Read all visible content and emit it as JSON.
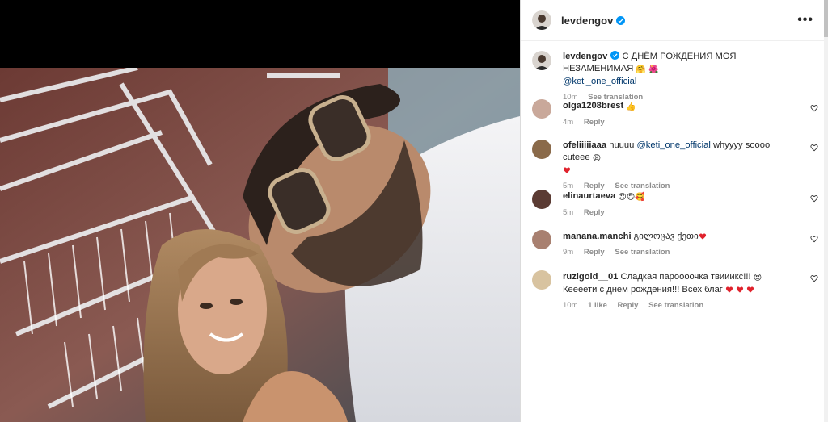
{
  "post": {
    "author": "levdengov",
    "more_icon": "more-horizontal-icon",
    "caption": {
      "user": "levdengov",
      "text": "С ДНЁМ РОЖДЕНИЯ МОЯ НЕЗАМЕНИМАЯ",
      "emojis": [
        "🤗",
        "🌺"
      ],
      "mention": "@keti_one_official",
      "time": "10m",
      "see_translation": "See translation"
    }
  },
  "comments": [
    {
      "user": "olga1208brest",
      "text": "",
      "emoji_after": "👍",
      "time": "4m",
      "reply": "Reply",
      "see_translation": "",
      "likes": "",
      "avatar_color": "#c9a89a"
    },
    {
      "user": "ofeliiiiiaaa",
      "text_before": "nuuuu",
      "mention": "@keti_one_official",
      "text": "whyyyy soooo cuteee",
      "emoji_after": "😩",
      "time": "5m",
      "reply": "Reply",
      "see_translation": "See translation",
      "likes": "",
      "avatar_color": "#8a6a4a"
    },
    {
      "user": "elinaurtaeva",
      "text": "",
      "emoji_after": "😍😍🥰",
      "time": "5m",
      "reply": "Reply",
      "see_translation": "",
      "likes": "",
      "avatar_color": "#5b3b33"
    },
    {
      "user": "manana.manchi",
      "text": "გილოცავ ქეთი",
      "emoji_after": "",
      "time": "9m",
      "reply": "Reply",
      "see_translation": "See translation",
      "likes": "",
      "avatar_color": "#a88070"
    },
    {
      "user": "ruzigold__01",
      "text": "Сладкая пароооочка твииикс!!!",
      "emoji_after": "😍",
      "text2": "Кеееети с днем рождения!!! Всех благ",
      "time": "10m",
      "reply": "Reply",
      "see_translation": "See translation",
      "likes": "1 like",
      "avatar_color": "#d8c3a0"
    }
  ],
  "colors": {
    "link": "#00376b",
    "meta": "#8e8e8e",
    "heart": "#ed4956",
    "verified": "#0095f6"
  }
}
